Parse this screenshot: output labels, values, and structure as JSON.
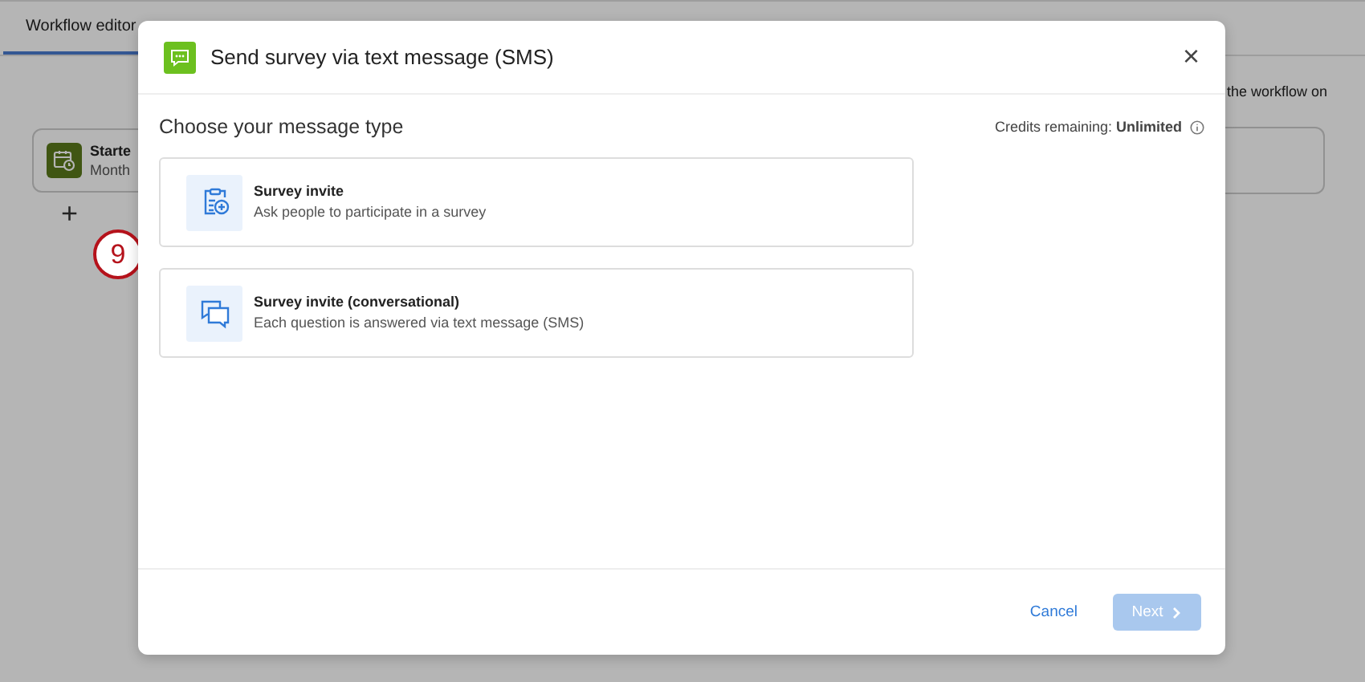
{
  "background": {
    "tab": "Workflow editor",
    "task_card": {
      "title": "Starte",
      "subtitle": "Month"
    },
    "add_symbol": "+",
    "side_text": "the workflow on"
  },
  "step_marker": "9",
  "dialog": {
    "title": "Send survey via text message (SMS)",
    "close_symbol": "×",
    "heading": "Choose your message type",
    "credits": "Credits remaining: **Unlimited**",
    "options": [
      {
        "kind": "invite",
        "title": "Survey invite",
        "description": "Ask people to participate in a survey",
        "selected": false
      },
      {
        "kind": "conversational",
        "title": "Survey invite (conversational)",
        "description": "Each question is answered via text message (SMS)",
        "selected": false
      }
    ],
    "cancel": "Cancel",
    "next": {
      "label": "Next",
      "disabled": true
    }
  }
}
